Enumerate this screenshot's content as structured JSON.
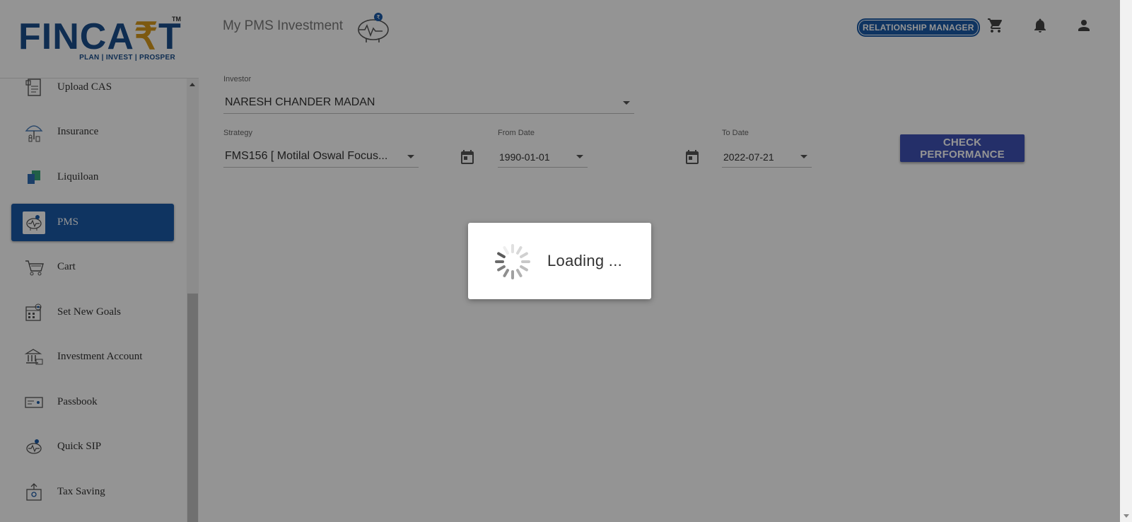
{
  "brand": {
    "logo_main": "FINCA",
    "logo_rupee": "₹",
    "logo_end": "T",
    "logo_tm": "TM",
    "logo_tagline": "PLAN | INVEST | PROSPER"
  },
  "sidebar": {
    "items": [
      {
        "label": "Upload CAS",
        "icon": "upload-cas-icon",
        "active": false
      },
      {
        "label": "Insurance",
        "icon": "insurance-umbrella-icon",
        "active": false
      },
      {
        "label": "Liquiloan",
        "icon": "liquiloan-icon",
        "active": false
      },
      {
        "label": "PMS",
        "icon": "pms-piggy-icon",
        "active": true
      },
      {
        "label": "Cart",
        "icon": "cart-icon",
        "active": false
      },
      {
        "label": "Set New Goals",
        "icon": "goals-icon",
        "active": false
      },
      {
        "label": "Investment Account",
        "icon": "bank-icon",
        "active": false
      },
      {
        "label": "Passbook",
        "icon": "passbook-icon",
        "active": false
      },
      {
        "label": "Quick SIP",
        "icon": "quick-sip-icon",
        "active": false
      },
      {
        "label": "Tax Saving",
        "icon": "tax-saving-icon",
        "active": false
      }
    ]
  },
  "header": {
    "title": "My PMS Investment",
    "role_badge": "RELATIONSHIP  MANAGER"
  },
  "form": {
    "investor_label": "Investor",
    "investor_value": "NARESH CHANDER MADAN",
    "strategy_label": "Strategy",
    "strategy_value": "FMS156 [ Motilal Oswal Focus...",
    "from_label": "From Date",
    "from_value": "1990-01-01",
    "to_label": "To Date",
    "to_value": "2022-07-21",
    "check_button": "CHECK PERFORMANCE"
  },
  "loading": {
    "text": "Loading  ..."
  },
  "colors": {
    "brand_blue": "#1b5ba7",
    "button_indigo": "#3f51b5",
    "logo_gold": "#d89a1c",
    "overlay": "rgba(0,0,0,0.42)"
  }
}
